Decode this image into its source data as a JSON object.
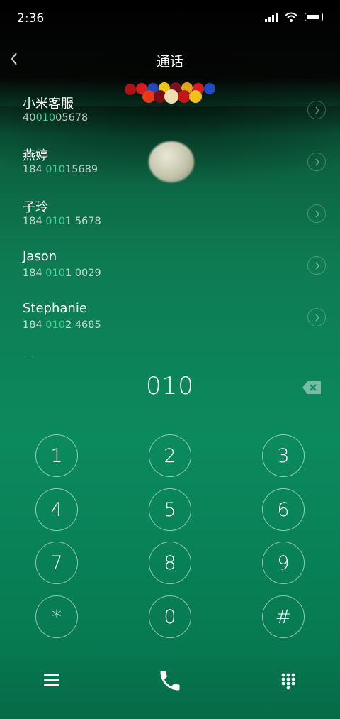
{
  "status_bar": {
    "time": "2:36",
    "icons": [
      "signal-icon",
      "wifi-icon",
      "battery-icon"
    ]
  },
  "header": {
    "title": "通话",
    "back_icon": "chevron-left-icon"
  },
  "contacts": [
    {
      "name": "小米客服",
      "number_pre": "40",
      "number_match": "010",
      "number_post": "05678"
    },
    {
      "name": "燕婷",
      "number_pre": "184 ",
      "number_match": "010",
      "number_post": "15689"
    },
    {
      "name": "子玲",
      "number_pre": "184 ",
      "number_match": "010",
      "number_post": "1 5678"
    },
    {
      "name": "Jason",
      "number_pre": "184 ",
      "number_match": "010",
      "number_post": "1 0029"
    },
    {
      "name": "Stephanie",
      "number_pre": "184 ",
      "number_match": "010",
      "number_post": "2 4685"
    }
  ],
  "dialer": {
    "input": "010",
    "delete_icon": "backspace-icon"
  },
  "keypad": [
    [
      "1",
      "2",
      "3"
    ],
    [
      "4",
      "5",
      "6"
    ],
    [
      "7",
      "8",
      "9"
    ],
    [
      "*",
      "0",
      "#"
    ]
  ],
  "bottom_bar": {
    "icons": [
      "menu-icon",
      "phone-icon",
      "dialpad-icon"
    ]
  },
  "colors": {
    "match_highlight": "#3fd394",
    "background_green": "#0b8a5e"
  }
}
